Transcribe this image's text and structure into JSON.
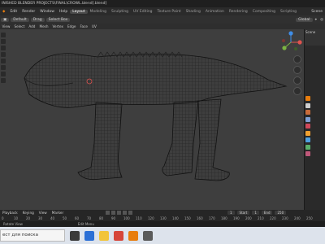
{
  "title_bar": {
    "text": "INISHED BLENDER PROJECTS\\FINAL\\CROWL.blend[.blend]"
  },
  "menu": {
    "items": [
      "Edit",
      "Render",
      "Window",
      "Help"
    ],
    "workspaces": [
      "Layout",
      "Modeling",
      "Sculpting",
      "UV Editing",
      "Texture Paint",
      "Shading",
      "Animation",
      "Rendering",
      "Compositing",
      "Scripting"
    ],
    "active_workspace": "Layout",
    "scene": "Scene"
  },
  "header": {
    "global": "Global",
    "drag": "Drag",
    "select_mode": "Select Box",
    "orientation": "Default"
  },
  "view_header": [
    "View",
    "Select",
    "Add",
    "Mesh",
    "Vertex",
    "Edge",
    "Face",
    "UV"
  ],
  "viewport": {
    "label": "Wireframe mesh: creature model (Edit Mode)"
  },
  "sidepanel": {
    "top_label": "Scene"
  },
  "timeline": {
    "menus": [
      "Playback",
      "Keying",
      "View",
      "Marker"
    ],
    "current_frame": "1",
    "start_label": "Start",
    "start": "1",
    "end_label": "End",
    "end": "250",
    "ticks": [
      "0",
      "10",
      "20",
      "30",
      "40",
      "50",
      "60",
      "70",
      "80",
      "90",
      "100",
      "110",
      "120",
      "130",
      "140",
      "150",
      "160",
      "170",
      "180",
      "190",
      "200",
      "210",
      "220",
      "230",
      "240",
      "250"
    ]
  },
  "statusbar": {
    "left": "Rotate View",
    "right": "Edit Menu"
  },
  "taskbar": {
    "search_placeholder": "ест для поиска"
  },
  "colors": {
    "accent": "#e87d0d",
    "x_axis": "#e0534f",
    "y_axis": "#7cb342",
    "z_axis": "#3f8ee8"
  }
}
